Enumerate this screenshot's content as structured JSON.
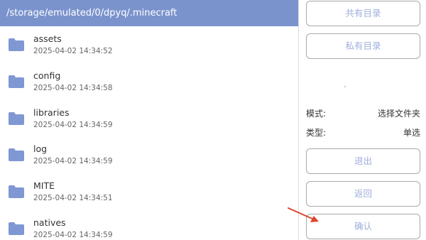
{
  "path": "/storage/emulated/0/dpyq/.minecraft",
  "files": [
    {
      "name": "assets",
      "date": "2025-04-02 14:34:52"
    },
    {
      "name": "config",
      "date": "2025-04-02 14:34:58"
    },
    {
      "name": "libraries",
      "date": "2025-04-02 14:34:59"
    },
    {
      "name": "log",
      "date": "2025-04-02 14:34:59"
    },
    {
      "name": "MITE",
      "date": "2025-04-02 14:34:51"
    },
    {
      "name": "natives",
      "date": "2025-04-02 14:34:59"
    }
  ],
  "buttons": {
    "shared_dir": "共有目录",
    "private_dir": "私有目录",
    "exit": "退出",
    "back": "返回",
    "confirm": "确认"
  },
  "info": {
    "mode_label": "模式:",
    "mode_value": "选择文件夹",
    "type_label": "类型:",
    "type_value": "单选"
  },
  "icons": {
    "folder": "folder-icon",
    "annotation": "red-arrow-icon"
  },
  "colors": {
    "path_bar": "#7b93cd",
    "folder": "#7f97d3",
    "button_text": "#9fb0dc",
    "arrow": "#e0452e"
  }
}
